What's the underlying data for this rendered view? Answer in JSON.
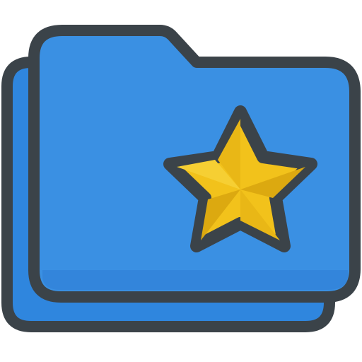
{
  "icon": {
    "name": "starred-folder-icon",
    "colors": {
      "outline": "#3b4349",
      "back_folder_fill": "#2f86de",
      "front_folder_fill": "#3a90e3",
      "front_folder_shadow": "#2e7fd6",
      "star_fill": "#f2c21b",
      "star_shade": "#d9a90f"
    }
  }
}
